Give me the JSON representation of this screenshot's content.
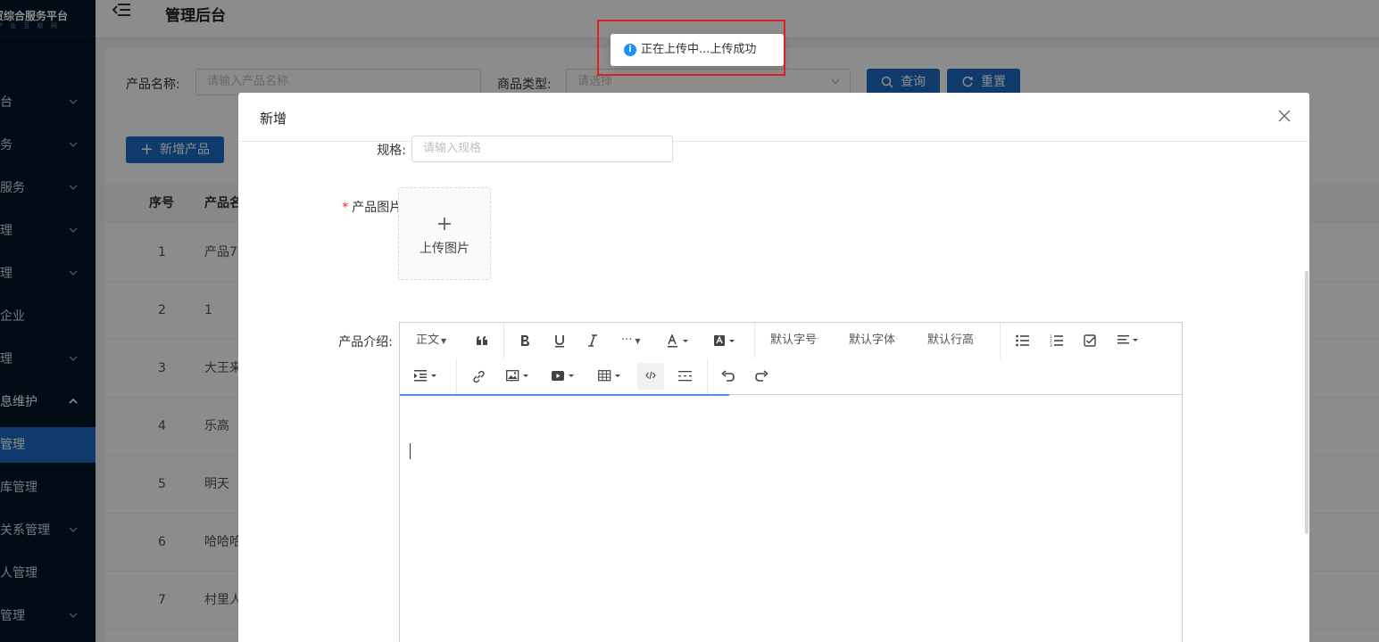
{
  "brand": {
    "name": "贸综合服务平台",
    "subtitle": "产 业 互 联 网"
  },
  "header": {
    "title": "管理后台"
  },
  "sidebar": {
    "items": [
      {
        "label": "台",
        "has_chevron": true,
        "chevron": "down"
      },
      {
        "label": "务",
        "has_chevron": true,
        "chevron": "down"
      },
      {
        "label": "服务",
        "has_chevron": true,
        "chevron": "down"
      },
      {
        "label": "理",
        "has_chevron": true,
        "chevron": "down"
      },
      {
        "label": "理",
        "has_chevron": true,
        "chevron": "down"
      },
      {
        "label": "企业",
        "has_chevron": false
      },
      {
        "label": "理",
        "has_chevron": true,
        "chevron": "down"
      },
      {
        "label": "息维护",
        "has_chevron": true,
        "chevron": "up",
        "bright": true
      },
      {
        "label": "管理",
        "active": true
      },
      {
        "label": "库管理",
        "has_chevron": false
      },
      {
        "label": "关系管理",
        "has_chevron": true,
        "chevron": "down"
      },
      {
        "label": "人管理",
        "has_chevron": false
      },
      {
        "label": "管理",
        "has_chevron": true,
        "chevron": "down"
      }
    ]
  },
  "filters": {
    "product_name_label": "产品名称:",
    "product_name_placeholder": "请输入产品名称",
    "product_type_label": "商品类型:",
    "product_type_placeholder": "请选择",
    "search_label": "查询",
    "reset_label": "重置",
    "add_label": "新增产品"
  },
  "table": {
    "headers": [
      "序号",
      "产品名"
    ],
    "rows": [
      [
        "1",
        "产品7"
      ],
      [
        "2",
        "1"
      ],
      [
        "3",
        "大王来"
      ],
      [
        "4",
        "乐高"
      ],
      [
        "5",
        "明天"
      ],
      [
        "6",
        "哈哈哈"
      ],
      [
        "7",
        "村里人"
      ]
    ]
  },
  "modal": {
    "title": "新增",
    "spec_label": "规格:",
    "spec_placeholder": "请输入规格",
    "image_label": "产品图片:",
    "upload_label": "上传图片",
    "intro_label": "产品介绍:"
  },
  "editor": {
    "paragraph": "正文",
    "font_size": "默认字号",
    "font_family": "默认字体",
    "line_height": "默认行高"
  },
  "toast": {
    "message": "正在上传中...上传成功",
    "icon": "info-icon"
  },
  "colors": {
    "sidebar": "#001529",
    "primary": "#1b6cc4",
    "highlight": "#e02020",
    "info": "#1890ff"
  }
}
